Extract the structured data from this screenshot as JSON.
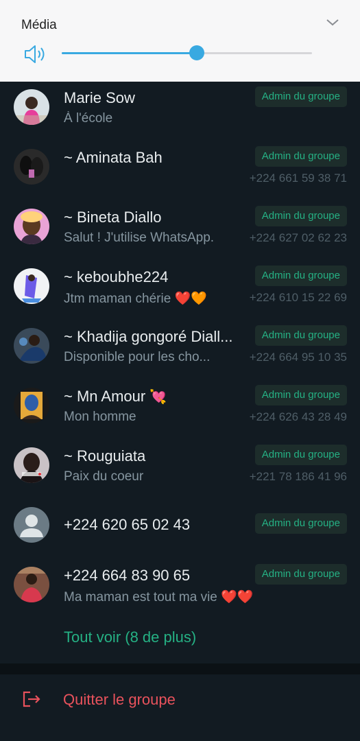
{
  "volume": {
    "title": "Média",
    "level": 0.54,
    "accent": "#39a9e1",
    "icons": {
      "speaker": "speaker-icon",
      "collapse": "chevron-down-icon"
    }
  },
  "members": [
    {
      "name": "Marie Sow",
      "status": "À l'école",
      "badge": "Admin du groupe",
      "phone": ""
    },
    {
      "name": "~ Aminata Bah",
      "status": "",
      "badge": "Admin du groupe",
      "phone": "+224 661 59 38 71"
    },
    {
      "name": "~ Bineta Diallo",
      "status": "Salut ! J'utilise WhatsApp.",
      "badge": "Admin du groupe",
      "phone": "+224 627 02 62 23"
    },
    {
      "name": "~ keboubhe224",
      "status": "Jtm maman chérie",
      "status_emoji": "❤️🧡",
      "badge": "Admin du groupe",
      "phone": "+224 610 15 22 69"
    },
    {
      "name": "~ Khadija gongoré Diall...",
      "status": "Disponible pour les cho...",
      "badge": "Admin du groupe",
      "phone": "+224 664 95 10 35"
    },
    {
      "name": "~ Mn Amour",
      "name_emoji": "💘",
      "status": "Mon homme",
      "badge": "Admin du groupe",
      "phone": "+224 626 43 28 49"
    },
    {
      "name": "~ Rouguiata",
      "status": "Paix du coeur",
      "badge": "Admin du groupe",
      "phone": "+221 78 186 41 96"
    },
    {
      "name": "+224 620 65 02 43",
      "status": "",
      "badge": "Admin du groupe",
      "phone": ""
    },
    {
      "name": "+224 664 83 90 65",
      "status": "Ma maman est tout ma vie",
      "status_emoji": "❤️❤️",
      "badge": "Admin du groupe",
      "phone": ""
    }
  ],
  "see_all": "Tout voir (8 de plus)",
  "exit": {
    "label": "Quitter le groupe",
    "icon": "exit-icon"
  },
  "colors": {
    "background": "#121b22",
    "accent_green": "#25b184",
    "danger": "#e9525c"
  }
}
